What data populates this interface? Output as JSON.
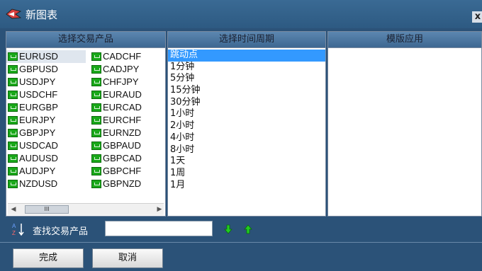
{
  "window": {
    "title": "新图表",
    "close": "x"
  },
  "headers": {
    "symbols": "选择交易产品",
    "timeframes": "选择时间周期",
    "templates": "模版应用"
  },
  "symbols_col1": [
    "EURUSD",
    "GBPUSD",
    "USDJPY",
    "USDCHF",
    "EURGBP",
    "EURJPY",
    "GBPJPY",
    "USDCAD",
    "AUDUSD",
    "AUDJPY",
    "NZDUSD"
  ],
  "symbols_col2": [
    "CADCHF",
    "CADJPY",
    "CHFJPY",
    "EURAUD",
    "EURCAD",
    "EURCHF",
    "EURNZD",
    "GBPAUD",
    "GBPCAD",
    "GBPCHF",
    "GBPNZD"
  ],
  "timeframes": [
    "跳动点",
    "1分钟",
    "5分钟",
    "15分钟",
    "30分钟",
    "1小时",
    "2小时",
    "4小时",
    "8小时",
    "1天",
    "1周",
    "1月"
  ],
  "scroll": {
    "left": "◀",
    "right": "▶",
    "thumb": "III"
  },
  "search": {
    "label": "查找交易产品",
    "value": "",
    "placeholder": ""
  },
  "buttons": {
    "ok": "完成",
    "cancel": "取消"
  },
  "colors": {
    "background": "#2b5278",
    "selection": "#3399ff",
    "symbol_icon": "#1aa81a"
  },
  "icons": {
    "app": "chart-bird-icon",
    "sort": "sort-az-icon",
    "down": "arrow-down-icon",
    "up": "arrow-up-icon"
  }
}
